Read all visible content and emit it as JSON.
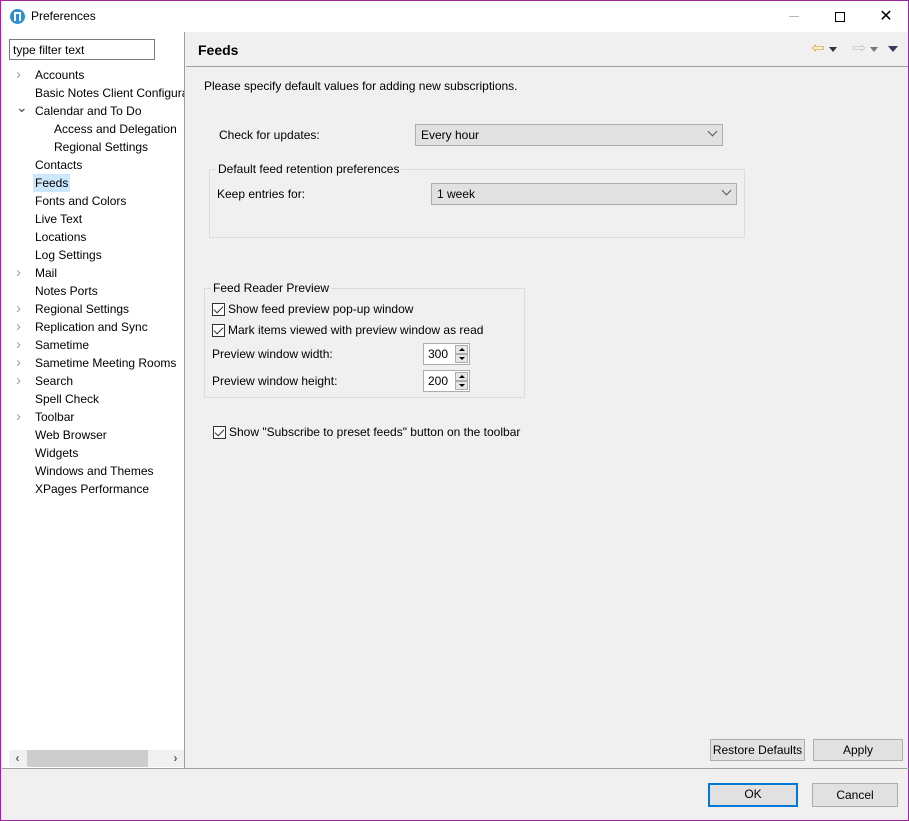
{
  "window": {
    "title": "Preferences",
    "icon": "notes-app-icon",
    "controls": {
      "minimize": "minimize-icon",
      "maximize": "maximize-icon",
      "close": "close-icon"
    }
  },
  "sidebar": {
    "filter_placeholder": "type filter text",
    "filter_value": "type filter text",
    "items": [
      {
        "label": "Accounts",
        "level": 1,
        "expander": "collapsed"
      },
      {
        "label": "Basic Notes Client Configura",
        "level": 1,
        "expander": "none"
      },
      {
        "label": "Calendar and To Do",
        "level": 1,
        "expander": "expanded"
      },
      {
        "label": "Access and Delegation",
        "level": 2,
        "expander": "none"
      },
      {
        "label": "Regional Settings",
        "level": 2,
        "expander": "none"
      },
      {
        "label": "Contacts",
        "level": 1,
        "expander": "none"
      },
      {
        "label": "Feeds",
        "level": 1,
        "expander": "none",
        "selected": true
      },
      {
        "label": "Fonts and Colors",
        "level": 1,
        "expander": "none"
      },
      {
        "label": "Live Text",
        "level": 1,
        "expander": "none"
      },
      {
        "label": "Locations",
        "level": 1,
        "expander": "none"
      },
      {
        "label": "Log Settings",
        "level": 1,
        "expander": "none"
      },
      {
        "label": "Mail",
        "level": 1,
        "expander": "collapsed"
      },
      {
        "label": "Notes Ports",
        "level": 1,
        "expander": "none"
      },
      {
        "label": "Regional Settings",
        "level": 1,
        "expander": "collapsed"
      },
      {
        "label": "Replication and Sync",
        "level": 1,
        "expander": "collapsed"
      },
      {
        "label": "Sametime",
        "level": 1,
        "expander": "collapsed"
      },
      {
        "label": "Sametime Meeting Rooms",
        "level": 1,
        "expander": "collapsed"
      },
      {
        "label": "Search",
        "level": 1,
        "expander": "collapsed"
      },
      {
        "label": "Spell Check",
        "level": 1,
        "expander": "none"
      },
      {
        "label": "Toolbar",
        "level": 1,
        "expander": "collapsed"
      },
      {
        "label": "Web Browser",
        "level": 1,
        "expander": "none"
      },
      {
        "label": "Widgets",
        "level": 1,
        "expander": "none"
      },
      {
        "label": "Windows and Themes",
        "level": 1,
        "expander": "none"
      },
      {
        "label": "XPages Performance",
        "level": 1,
        "expander": "none"
      }
    ],
    "scroll_left": "‹",
    "scroll_right": "›"
  },
  "main": {
    "title": "Feeds",
    "nav": {
      "back": "⇦",
      "forward": "⇨"
    },
    "intro": "Please specify default values for adding new subscriptions.",
    "check_updates": {
      "label": "Check for updates:",
      "value": "Every hour"
    },
    "retention": {
      "title": "Default feed retention preferences",
      "keep_label": "Keep entries for:",
      "keep_value": "1 week"
    },
    "preview": {
      "title": "Feed Reader Preview",
      "show_popup": {
        "label": "Show feed preview pop-up window",
        "checked": true
      },
      "mark_read": {
        "label": "Mark items viewed with preview window as read",
        "checked": true
      },
      "width_label": "Preview window width:",
      "width_value": "300",
      "height_label": "Preview window height:",
      "height_value": "200"
    },
    "subscribe_button": {
      "label": "Show \"Subscribe to preset feeds\" button on the toolbar",
      "checked": true
    },
    "restore_defaults": "Restore Defaults",
    "apply": "Apply"
  },
  "footer": {
    "ok": "OK",
    "cancel": "Cancel"
  },
  "colors": {
    "window_border": "#a1259a",
    "selection": "#cce8ff",
    "default_button_border": "#0078d7",
    "back_arrow": "#e8b020"
  }
}
